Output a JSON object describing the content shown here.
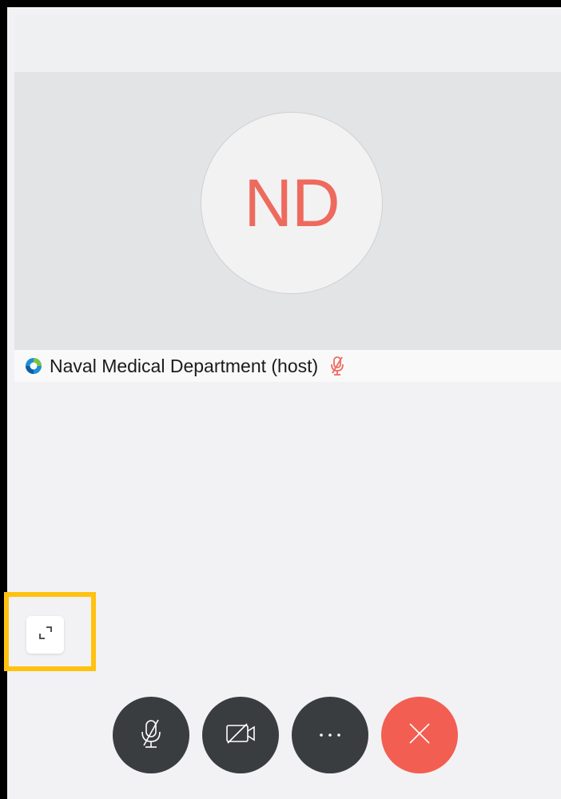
{
  "participant": {
    "initials": "ND",
    "name": "Naval Medical Department (host)",
    "muted": true
  },
  "controls": {
    "mute_icon": "microphone-muted-icon",
    "video_icon": "video-off-icon",
    "more_icon": "more-options-icon",
    "more_label": "···",
    "leave_icon": "close-icon"
  },
  "icons": {
    "app": "app-logo-icon",
    "expand": "expand-icon",
    "name_mute": "microphone-muted-icon"
  },
  "colors": {
    "accent_red": "#f35e52",
    "initials": "#ee6a5e",
    "control_dark": "#3a3d40",
    "highlight": "#ffc20e"
  }
}
